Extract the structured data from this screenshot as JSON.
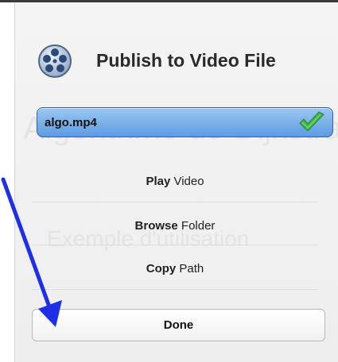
{
  "dialog": {
    "title": "Publish to Video File",
    "background_text": [
      "Algorithme de Dijkstra",
      "Exemple d'utilisation"
    ]
  },
  "file": {
    "name": "algo.mp4",
    "status_icon": "green-check-icon"
  },
  "actions": [
    {
      "verb": "Play",
      "object": "Video"
    },
    {
      "verb": "Browse",
      "object": "Folder"
    },
    {
      "verb": "Copy",
      "object": "Path"
    }
  ],
  "done_label": "Done",
  "annotation": {
    "arrow_color": "#1f2fe8"
  },
  "colors": {
    "field_blue": "#6aa6e6",
    "check_green": "#3fb54a"
  }
}
